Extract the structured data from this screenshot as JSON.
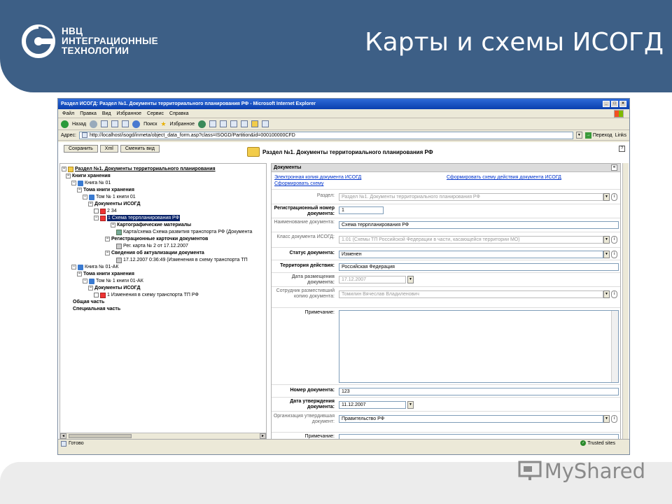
{
  "slide": {
    "logo_line1": "НВЦ",
    "logo_line2": "ИНТЕГРАЦИОННЫЕ",
    "logo_line3": "ТЕХНОЛОГИИ",
    "title": "Карты и схемы ИСОГД",
    "watermark": "MyShared",
    "colors": {
      "banner": "#3d5f86",
      "accent": "#ffffff"
    }
  },
  "browser": {
    "title": "Раздел ИСОГД: Раздел №1. Документы территориального планирования РФ - Microsoft Internet Explorer",
    "menu": [
      "Файл",
      "Правка",
      "Вид",
      "Избранное",
      "Сервис",
      "Справка"
    ],
    "toolbar": {
      "back": "Назад",
      "search": "Поиск",
      "favorites": "Избранное"
    },
    "address_label": "Адрес:",
    "address": "http://localhost/isogd/inmeta/object_data_form.asp?class=ISOGD/Partition&id=000100000CFD",
    "go": "Переход",
    "links": "Links",
    "status": "Готово",
    "zone": "Trusted sites"
  },
  "toolbar": {
    "save": "Сохранить",
    "xml": "Xml",
    "change_view": "Сменить вид"
  },
  "doc_header": "Раздел №1. Документы территориального планирования РФ",
  "tree": {
    "root": "Раздел №1. Документы территориального планирования",
    "books": "Книги хранения",
    "book1": "Книга № 01",
    "volumes": "Тома книги хранения",
    "vol1": "Том № 1 книги 01",
    "isogd_docs": "Документы ИСОГД",
    "doc_234": "2 34",
    "doc_selected": "1 Схема террпланирования РФ",
    "carto": "Картографические материалы",
    "map": "Карта/схема Схема развития транспорта РФ (Документа",
    "reg_cards": "Регистрационные карточки документов",
    "reg_card": "Рег. карта № 2 от 17.12.2007",
    "actual": "Сведения об актуализации документа",
    "actual_item": "17.12.2007 0:36:49 (Изменения в схему транспорта ТП",
    "book2": "Книга № 01-АК",
    "volumes2": "Тома книги хранения",
    "vol2": "Том № 1 книги 01-АК",
    "isogd_docs2": "Документы ИСОГД",
    "doc_change": "1 Изменения в схему транспорта ТП РФ",
    "general": "Общая часть",
    "special": "Специальная часть"
  },
  "form": {
    "section_title": "Документы",
    "link_ecopy": "Электронная копия документа ИСОГД",
    "link_action": "Сформировать схему действия документа ИСОГД",
    "link_scheme": "Сформировать схему",
    "fields": {
      "razdel_label": "Раздел:",
      "razdel_value": "Раздел №1. Документы территориального планирования РФ",
      "regnum_label": "Регистрационный номер документа:",
      "regnum_value": "1",
      "name_label": "Наименование документа:",
      "name_value": "Схема террпланирования РФ",
      "class_label": "Класс документа ИСОГД:",
      "class_value": "1.01 (Схемы ТП Российской Федерации в части, касающейся территории МО)",
      "status_label": "Статус документа:",
      "status_value": "Изменен",
      "territory_label": "Территория действия:",
      "territory_value": "Российская Федерация",
      "date_label": "Дата размещения документа:",
      "date_value": "17.12.2007",
      "employee_label": "Сотрудник разместивший копию документа:",
      "employee_value": "Томилин Вячеслав Владиленович",
      "note_label": "Примечание:",
      "docnum_label": "Номер документа:",
      "docnum_value": "123",
      "approve_label": "Дата утверждения документа:",
      "approve_value": "11.12.2007",
      "org_label": "Организация утвердившая документ:",
      "org_value": "Правительство РФ",
      "note2_label": "Примечание:"
    }
  }
}
